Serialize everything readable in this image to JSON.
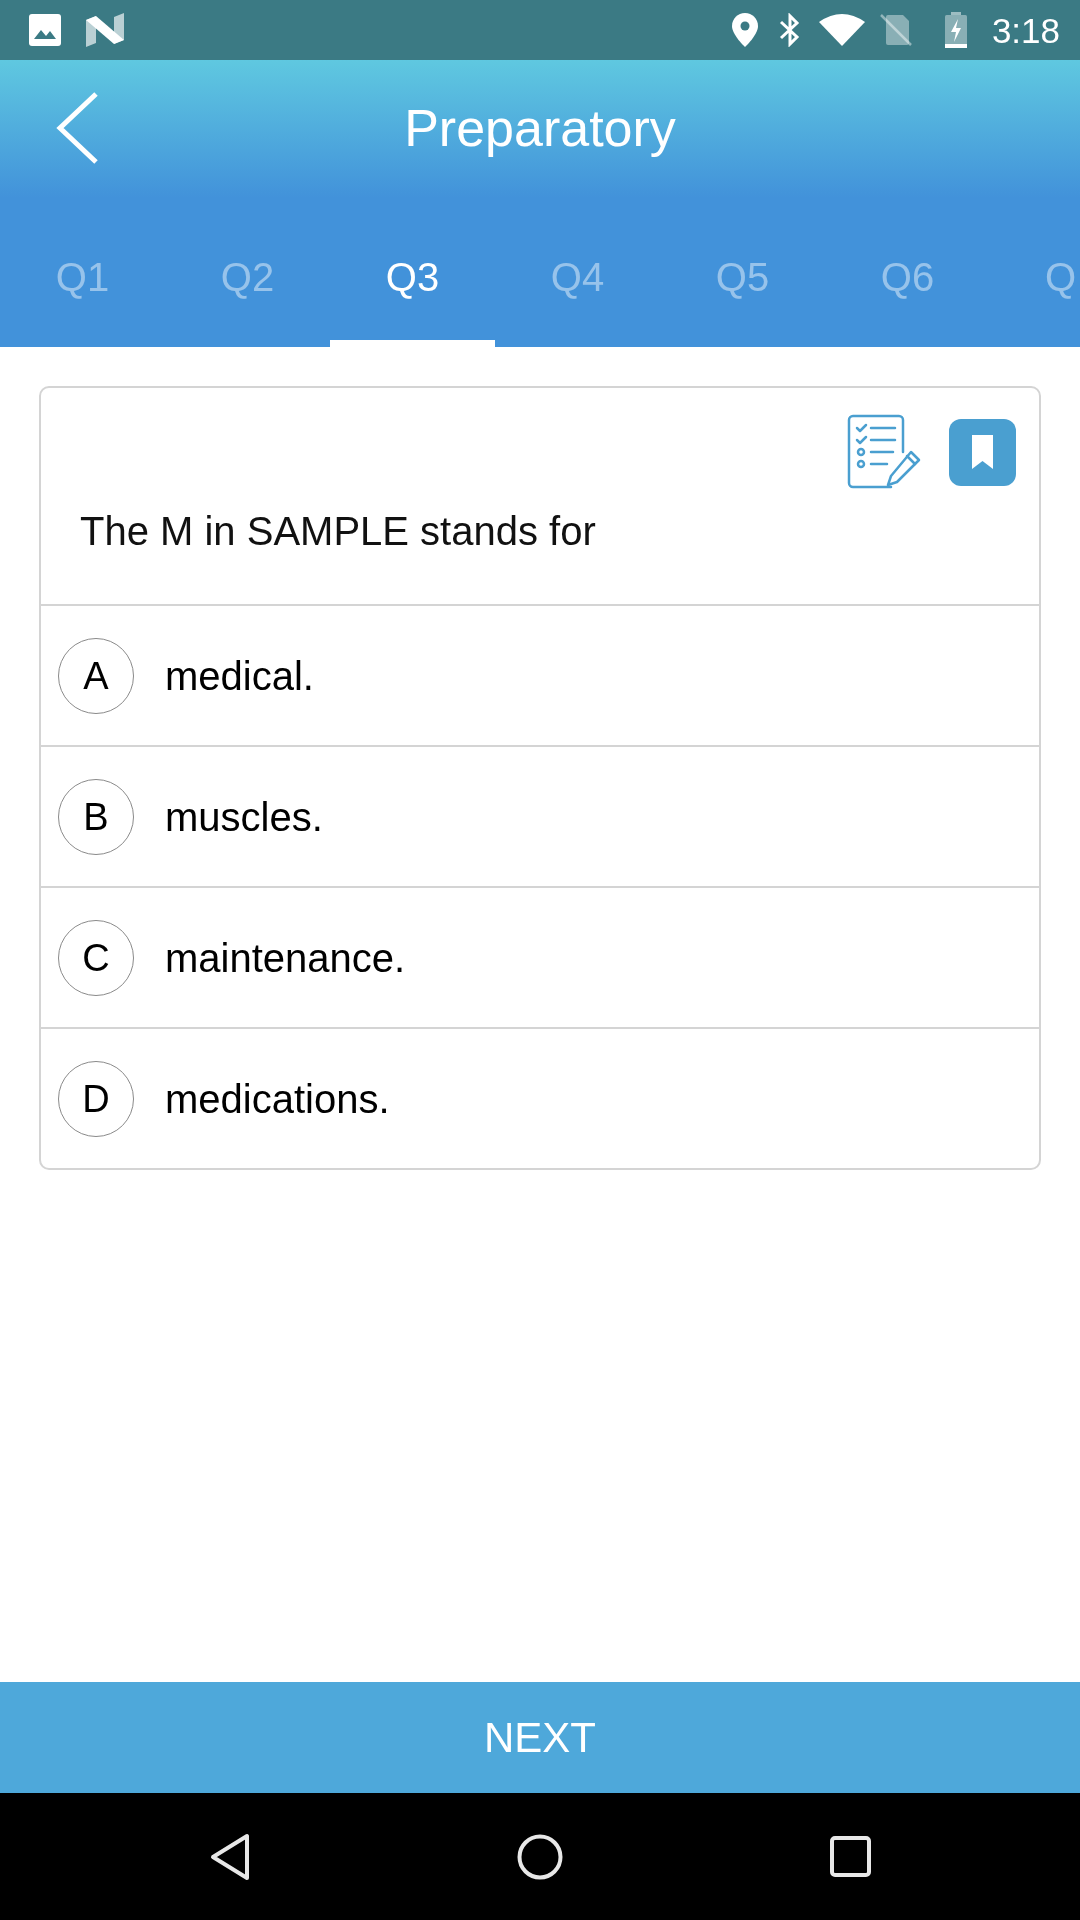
{
  "status_bar": {
    "time": "3:18"
  },
  "header": {
    "title": "Preparatory"
  },
  "tabs": [
    {
      "label": "Q1",
      "selected": false
    },
    {
      "label": "Q2",
      "selected": false
    },
    {
      "label": "Q3",
      "selected": true
    },
    {
      "label": "Q4",
      "selected": false
    },
    {
      "label": "Q5",
      "selected": false
    },
    {
      "label": "Q6",
      "selected": false
    },
    {
      "label": "Q",
      "selected": false
    }
  ],
  "question": {
    "text": "The M in SAMPLE stands for"
  },
  "options": [
    {
      "letter": "A",
      "text": "medical.",
      "selected": false
    },
    {
      "letter": "B",
      "text": "muscles.",
      "selected": false
    },
    {
      "letter": "C",
      "text": "maintenance.",
      "selected": false
    },
    {
      "letter": "D",
      "text": "medications.",
      "selected": false
    }
  ],
  "next_button": {
    "label": "NEXT"
  }
}
